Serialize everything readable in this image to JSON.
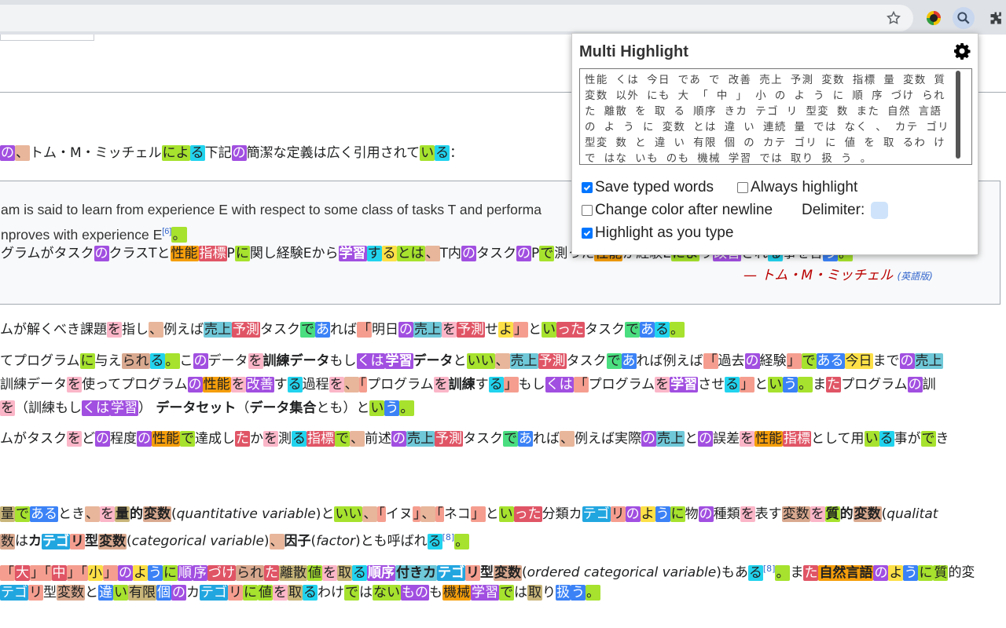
{
  "extension": {
    "title": "Multi Highlight",
    "words_value": "性能 くは 今日 であ で 改善 売上 予測 変数 指標 量 変数 質 変数 以外 にも 大 「 中 」 小 の よ う に 順 序 づけ られ た 離散 を 取 る 順序 きカ テゴ リ 型変 数 また 自然 言語 の よ う に 変数 とは 違 い 連続 量 では なく 、 カテ ゴリ 型変 数 と 違 い 有限 個 の カテ ゴリ に 値 を 取 るわ けで はな いも のも 機械 学習 では 取り 扱 う 。",
    "opt_save": "Save typed words",
    "opt_always": "Always highlight",
    "opt_color": "Change color after newline",
    "opt_delim_label": "Delimiter:",
    "opt_as_type": "Highlight as you type",
    "save_checked": true,
    "always_checked": false,
    "color_checked": false,
    "as_type_checked": true,
    "delimiter_color": "#cfe4fb"
  },
  "article": {
    "l1": [
      [
        "の",
        "#a14fe0",
        "#fff"
      ],
      [
        "、",
        "#d9a98f",
        ""
      ],
      [
        "トム・M・ミッチェル",
        ""
      ],
      [
        "によ",
        "#a6e22e",
        ""
      ],
      [
        "る",
        "#22d3ee",
        ""
      ],
      [
        "下記",
        ""
      ],
      [
        "の",
        "#a14fe0",
        "#fff"
      ],
      [
        "簡潔な定義は広く引用されて",
        ""
      ],
      [
        "い",
        "#a6e22e",
        ""
      ],
      [
        "る",
        "#22d3ee",
        ""
      ],
      [
        "：",
        ""
      ]
    ],
    "q1": "am is said to learn from experience E with respect to some class of tasks T and performa",
    "q2a": "nproves with experience E",
    "q2cite": "[6]",
    "q3": "グラムがタスクのクラスTと性能指標Pに関し経験Eから学習するとは、T内のタスクのPで測った性能が経験Eにより改善されることを言う。",
    "q_attr": "— トム・M・ミッチェル",
    "q_attr2": "(英語版)",
    "l2": "ムが解くべき課題を指し、例えば売上予測タスクであれば「明日の売上を予測せよ」といったタスクである。",
    "l3": "てプログラムに与えられる。このデータを訓練データもしくは学習データといい、売上予測タスクであれば例えば「過去の経験」である今日までの売上",
    "l4": "訓練データを使ってプログラムの性能を改善する過程を、「プログラムを訓練する」もしくは「プログラムを学習させる」という。またプログラムの訓",
    "l5": "を（訓練もしくは学習）データセット（データ集合とも）という。",
    "l6": "ムがタスクをどの程度の性能で達成したかを測る指標で、前述の売上予測タスクであれば、例えば実際の売上との誤差を性能指標として用いる事ができ",
    "l7": "量であるとき、を量的変数(quantitative variable)といい、「イヌ」、「ネコ」といった分類カテゴリのように物の種類を表す変数を質的変数(qualitat",
    "l8a": "数はカテゴリ型変数(categorical variable)、因子(factor)とも呼ばれる",
    "l8cite": "[8]",
    "l9a": "「大」「中」「小」のように順序づけられた離散値を取る順序付きカテゴリ型変数(ordered categorical variable)もある",
    "l9cite": "[8]",
    "l9b": "。また自然言語のように質的変",
    "l10": "テゴリ型変数と違い有限個のカテゴリに値を取るわけではないものも機械学習では取り扱う。"
  }
}
